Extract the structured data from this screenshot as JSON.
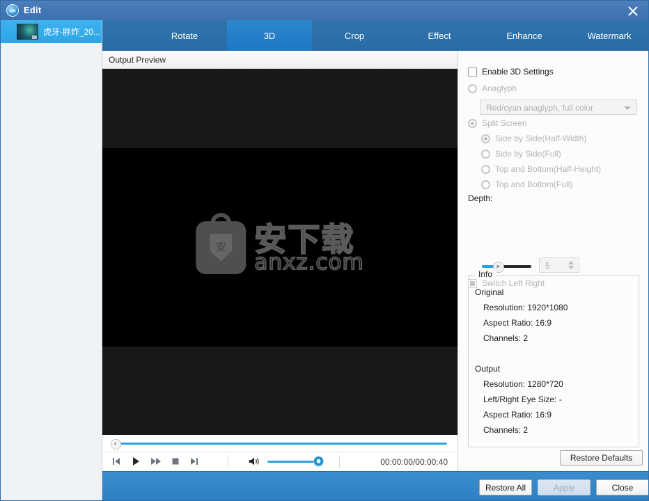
{
  "window": {
    "title": "Edit",
    "app_icon": "globe-icon",
    "close_icon": "close-icon"
  },
  "sidebar": {
    "files": [
      {
        "name": "虎牙-胖炸_20...",
        "thumb": "video-thumbnail",
        "selected": true
      }
    ]
  },
  "tabs": [
    {
      "label": "Rotate",
      "active": false
    },
    {
      "label": "3D",
      "active": true
    },
    {
      "label": "Crop",
      "active": false
    },
    {
      "label": "Effect",
      "active": false
    },
    {
      "label": "Enhance",
      "active": false
    },
    {
      "label": "Watermark",
      "active": false
    }
  ],
  "preview": {
    "header_label": "Output Preview",
    "watermark": {
      "chinese": "安下载",
      "english": "anxz.com",
      "badge_char": "安"
    },
    "seek": {
      "value": 0,
      "min": 0,
      "max": 100
    },
    "controls": [
      {
        "icon": "previous-icon",
        "name": "previous-button"
      },
      {
        "icon": "play-icon",
        "name": "play-button"
      },
      {
        "icon": "fast-forward-icon",
        "name": "fast-forward-button"
      },
      {
        "icon": "stop-icon",
        "name": "stop-button"
      },
      {
        "icon": "next-icon",
        "name": "next-button"
      }
    ],
    "volume": {
      "icon": "speaker-icon",
      "value": 100
    },
    "time": "00:00:00/00:00:40"
  },
  "settings": {
    "enable_3d": {
      "label": "Enable 3D Settings",
      "checked": false
    },
    "anaglyph": {
      "label": "Anaglyph",
      "selected": false,
      "disabled": true
    },
    "anaglyph_combo": {
      "value": "Red/cyan anaglyph, full color",
      "disabled": true
    },
    "split_screen": {
      "label": "Split Screen",
      "selected": true,
      "disabled": true
    },
    "split_options": [
      {
        "label": "Side by Side(Half-Width)",
        "selected": true
      },
      {
        "label": "Side by Side(Full)",
        "selected": false
      },
      {
        "label": "Top and Bottom(Half-Height)",
        "selected": false
      },
      {
        "label": "Top and Bottom(Full)",
        "selected": false
      }
    ],
    "depth": {
      "label": "Depth:",
      "value": "5",
      "slider_pct": 22
    },
    "switch_left_right": {
      "label": "Switch Left Right",
      "checked": true,
      "disabled": true
    },
    "info": {
      "group_title": "Info",
      "original": {
        "heading": "Original",
        "lines": [
          "Resolution: 1920*1080",
          "Aspect Ratio: 16:9",
          "Channels: 2"
        ]
      },
      "output": {
        "heading": "Output",
        "lines": [
          "Resolution: 1280*720",
          "Left/Right Eye Size: -",
          "Aspect Ratio: 16:9",
          "Channels: 2"
        ]
      }
    },
    "restore_defaults_label": "Restore Defaults"
  },
  "footer": {
    "restore_all_label": "Restore All",
    "apply_label": "Apply",
    "apply_disabled": true,
    "close_label": "Close"
  },
  "colors": {
    "titlebar": "#4275b3",
    "tabbar": "#2a6ba4",
    "tab_active": "#1f78c4",
    "accent": "#2aa3e0",
    "sidebar_bg": "#eff3f6",
    "selected_item": "#2ba6e8",
    "footer_bg": "#2f80c4"
  }
}
